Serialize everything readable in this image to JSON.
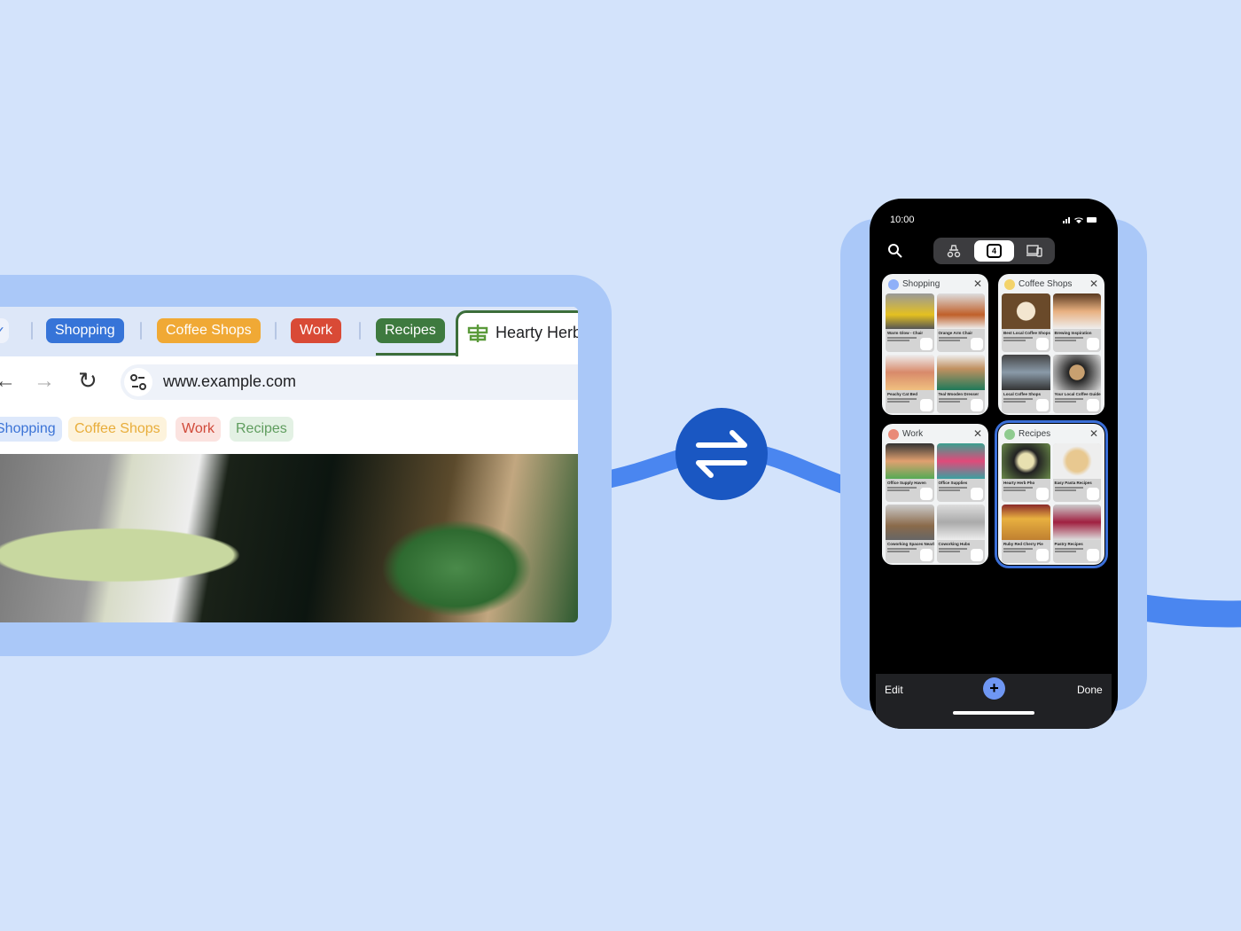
{
  "browser": {
    "tab_groups": [
      {
        "label": "Shopping",
        "color": "#3674d8"
      },
      {
        "label": "Coffee Shops",
        "color": "#f0a935"
      },
      {
        "label": "Work",
        "color": "#d94a36"
      },
      {
        "label": "Recipes",
        "color": "#3e7a3f"
      }
    ],
    "active_tab": {
      "title": "Hearty Herb",
      "icon": "signpost-icon"
    },
    "url": "www.example.com",
    "bookmarks": [
      {
        "label": "Shopping",
        "bg": "#dde8fb",
        "fg": "#3b73d6"
      },
      {
        "label": "Coffee Shops",
        "bg": "#fdf3dc",
        "fg": "#e8ad3a"
      },
      {
        "label": "Work",
        "bg": "#fbe3e0",
        "fg": "#d04a3a"
      },
      {
        "label": "Recipes",
        "bg": "#e3f1e4",
        "fg": "#5f9d5e"
      }
    ]
  },
  "sync_icon": "swap-arrows-icon",
  "accent": "#4285f4",
  "phone": {
    "time": "10:00",
    "tab_count": "4",
    "groups": [
      {
        "title": "Shopping",
        "color": "#8fb0f8",
        "tiles": [
          "Warm Glow - Chair",
          "Orange Arm Chair",
          "Peachy Cat Bed",
          "Teal Wooden Dresser"
        ]
      },
      {
        "title": "Coffee Shops",
        "color": "#f3d36b",
        "tiles": [
          "Best Local Coffee Shops",
          "Brewing Inspiration",
          "Local Coffee Shops",
          "Your Local Coffee Guide"
        ]
      },
      {
        "title": "Work",
        "color": "#e98a78",
        "tiles": [
          "Office Supply Haven",
          "Office Supplies",
          "Coworking Spaces Nearby",
          "Coworking Hubs"
        ]
      },
      {
        "title": "Recipes",
        "color": "#8fcb8f",
        "selected": true,
        "tiles": [
          "Hearty Herb Pho",
          "Easy Pasta Recipes",
          "Ruby Red Cherry Pie",
          "Pastry Recipes"
        ]
      }
    ],
    "edit_label": "Edit",
    "done_label": "Done"
  }
}
